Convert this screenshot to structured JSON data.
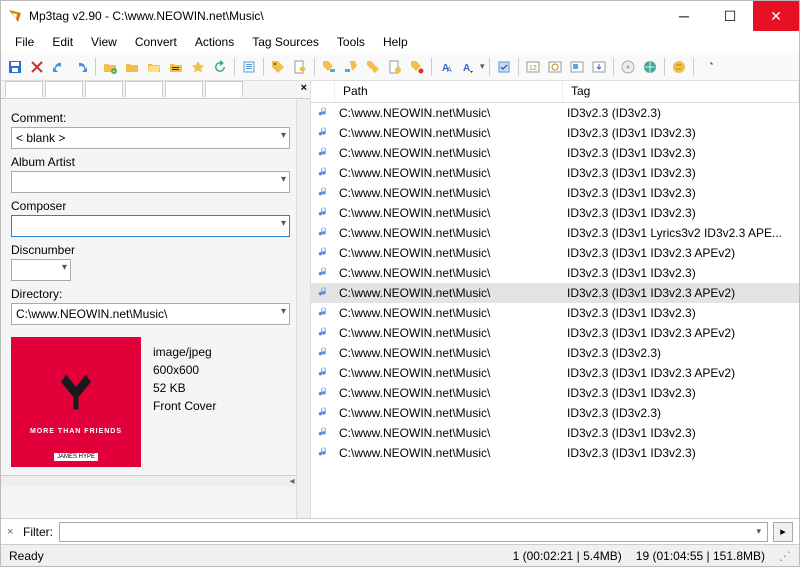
{
  "window": {
    "title": "Mp3tag v2.90  -  C:\\www.NEOWIN.net\\Music\\"
  },
  "menu": [
    "File",
    "Edit",
    "View",
    "Convert",
    "Actions",
    "Tag Sources",
    "Tools",
    "Help"
  ],
  "sidebar": {
    "comment_label": "Comment:",
    "comment_value": "< blank >",
    "album_artist_label": "Album Artist",
    "album_artist_value": "",
    "composer_label": "Composer",
    "composer_value": "",
    "discnumber_label": "Discnumber",
    "discnumber_value": "",
    "directory_label": "Directory:",
    "directory_value": "C:\\www.NEOWIN.net\\Music\\",
    "art": {
      "mime": "image/jpeg",
      "dims": "600x600",
      "size": "52 KB",
      "type": "Front Cover",
      "caption_top": "MORE THAN FRIENDS",
      "caption_bottom": "JAMES HYPE"
    }
  },
  "columns": {
    "path": "Path",
    "tag": "Tag"
  },
  "files": [
    {
      "path": "C:\\www.NEOWIN.net\\Music\\",
      "tag": "ID3v2.3 (ID3v2.3)"
    },
    {
      "path": "C:\\www.NEOWIN.net\\Music\\",
      "tag": "ID3v2.3 (ID3v1 ID3v2.3)"
    },
    {
      "path": "C:\\www.NEOWIN.net\\Music\\",
      "tag": "ID3v2.3 (ID3v1 ID3v2.3)"
    },
    {
      "path": "C:\\www.NEOWIN.net\\Music\\",
      "tag": "ID3v2.3 (ID3v1 ID3v2.3)"
    },
    {
      "path": "C:\\www.NEOWIN.net\\Music\\",
      "tag": "ID3v2.3 (ID3v1 ID3v2.3)"
    },
    {
      "path": "C:\\www.NEOWIN.net\\Music\\",
      "tag": "ID3v2.3 (ID3v1 ID3v2.3)"
    },
    {
      "path": "C:\\www.NEOWIN.net\\Music\\",
      "tag": "ID3v2.3 (ID3v1 Lyrics3v2 ID3v2.3 APE..."
    },
    {
      "path": "C:\\www.NEOWIN.net\\Music\\",
      "tag": "ID3v2.3 (ID3v1 ID3v2.3 APEv2)"
    },
    {
      "path": "C:\\www.NEOWIN.net\\Music\\",
      "tag": "ID3v2.3 (ID3v1 ID3v2.3)"
    },
    {
      "path": "C:\\www.NEOWIN.net\\Music\\",
      "tag": "ID3v2.3 (ID3v1 ID3v2.3 APEv2)",
      "selected": true
    },
    {
      "path": "C:\\www.NEOWIN.net\\Music\\",
      "tag": "ID3v2.3 (ID3v1 ID3v2.3)"
    },
    {
      "path": "C:\\www.NEOWIN.net\\Music\\",
      "tag": "ID3v2.3 (ID3v1 ID3v2.3 APEv2)"
    },
    {
      "path": "C:\\www.NEOWIN.net\\Music\\",
      "tag": "ID3v2.3 (ID3v2.3)"
    },
    {
      "path": "C:\\www.NEOWIN.net\\Music\\",
      "tag": "ID3v2.3 (ID3v1 ID3v2.3 APEv2)"
    },
    {
      "path": "C:\\www.NEOWIN.net\\Music\\",
      "tag": "ID3v2.3 (ID3v1 ID3v2.3)"
    },
    {
      "path": "C:\\www.NEOWIN.net\\Music\\",
      "tag": "ID3v2.3 (ID3v2.3)"
    },
    {
      "path": "C:\\www.NEOWIN.net\\Music\\",
      "tag": "ID3v2.3 (ID3v1 ID3v2.3)"
    },
    {
      "path": "C:\\www.NEOWIN.net\\Music\\",
      "tag": "ID3v2.3 (ID3v1 ID3v2.3)"
    }
  ],
  "filter": {
    "label": "Filter:",
    "value": ""
  },
  "status": {
    "left": "Ready",
    "mid": "1 (00:02:21 | 5.4MB)",
    "right": "19 (01:04:55 | 151.8MB)"
  }
}
